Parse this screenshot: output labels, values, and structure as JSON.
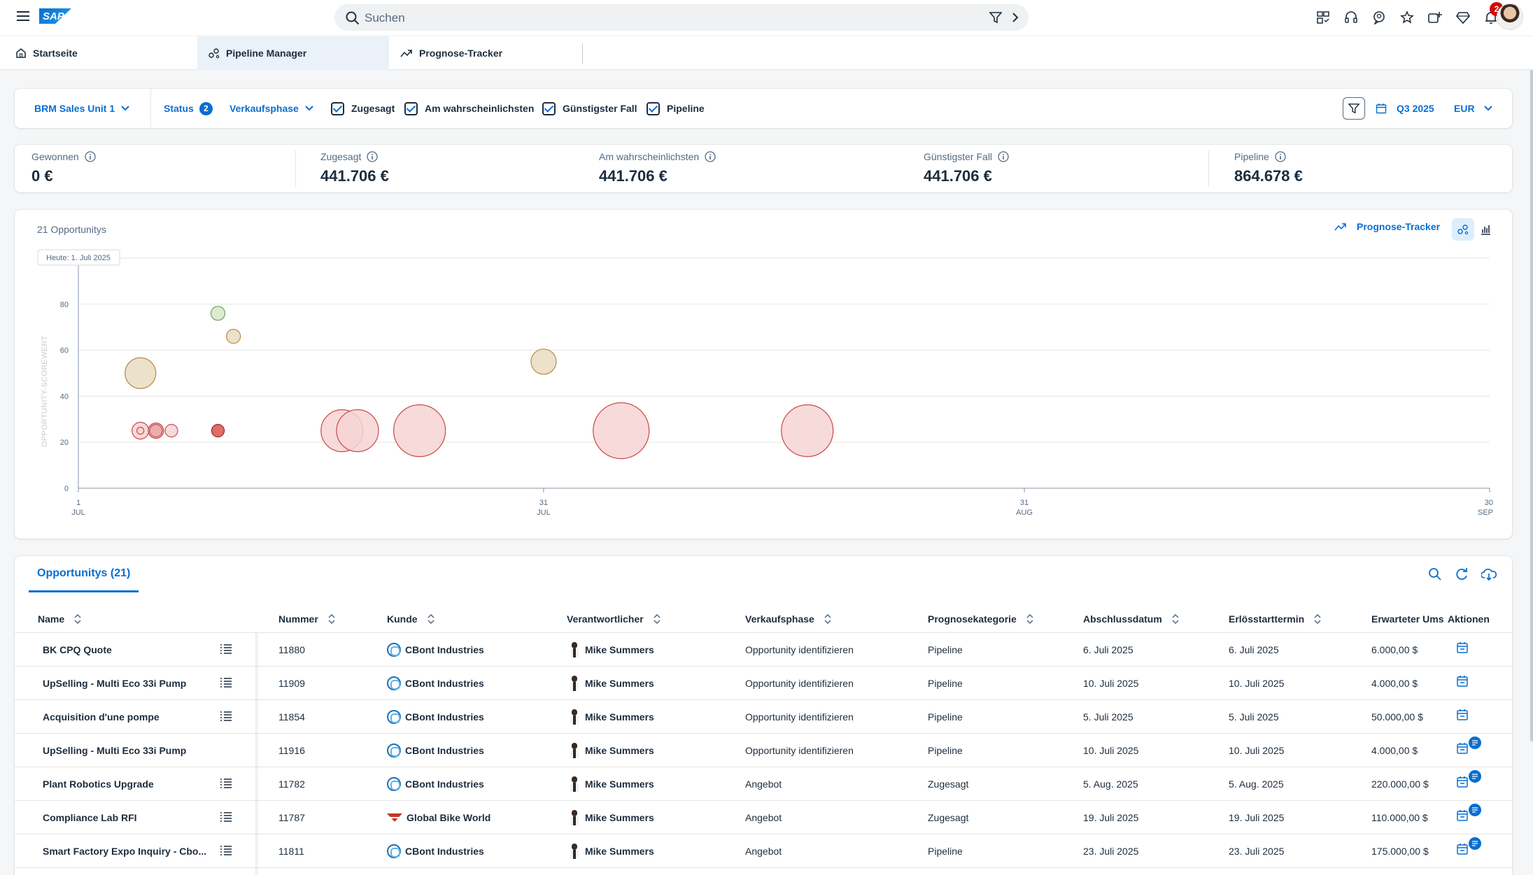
{
  "shell": {
    "logo": "SAP",
    "search_placeholder": "Suchen",
    "notification_count": "2",
    "icons": [
      "app-switcher-icon",
      "headset-icon",
      "chat-icon",
      "star-icon",
      "add-favorite-icon",
      "diamond-icon",
      "bell-icon"
    ]
  },
  "tabs": [
    {
      "label": "Startseite",
      "icon": "home-icon"
    },
    {
      "label": "Pipeline Manager",
      "icon": "pipeline-icon"
    },
    {
      "label": "Prognose-Tracker",
      "icon": "trend-icon"
    }
  ],
  "filterbar": {
    "unit": "BRM Sales Unit 1",
    "status_label": "Status",
    "status_count": "2",
    "phase": "Verkaufsphase",
    "checks": [
      "Zugesagt",
      "Am wahrscheinlichsten",
      "Günstigster Fall",
      "Pipeline"
    ],
    "period": "Q3 2025",
    "currency": "EUR"
  },
  "kpis": [
    {
      "label": "Gewonnen",
      "value": "0 €"
    },
    {
      "label": "Zugesagt",
      "value": "441.706 €"
    },
    {
      "label": "Am wahrscheinlichsten",
      "value": "441.706 €"
    },
    {
      "label": "Günstigster Fall",
      "value": "441.706 €"
    },
    {
      "label": "Pipeline",
      "value": "864.678 €"
    }
  ],
  "chart_header": {
    "count": "21 Opportunitys",
    "link": "Prognose-Tracker"
  },
  "chart_data": {
    "type": "scatter",
    "today_label": "Heute: 1. Juli 2025",
    "ylabel": "OPPORTUNITY-SCOREWERT",
    "xlabel": "",
    "ylim": [
      0,
      100
    ],
    "yticks": [
      0,
      20,
      40,
      60,
      80
    ],
    "xlim_days": [
      0,
      91
    ],
    "xticks": [
      {
        "day": 0,
        "d": "1",
        "m": "JUL"
      },
      {
        "day": 30,
        "d": "31",
        "m": "JUL"
      },
      {
        "day": 61,
        "d": "31",
        "m": "AUG"
      },
      {
        "day": 91,
        "d": "30",
        "m": "SEP"
      }
    ],
    "points": [
      {
        "day": 4,
        "y": 50,
        "r": 22,
        "c": "#e9dcc2",
        "s": "#b98a45"
      },
      {
        "day": 9,
        "y": 76,
        "r": 10,
        "c": "#d7e8c9",
        "s": "#6fa05a"
      },
      {
        "day": 10,
        "y": 66,
        "r": 10,
        "c": "#e9dcc2",
        "s": "#b98a45"
      },
      {
        "day": 30,
        "y": 55,
        "r": 18,
        "c": "#e9dcc2",
        "s": "#b98a45"
      },
      {
        "day": 4,
        "y": 25,
        "r": 12,
        "c": "#f6d3d3",
        "s": "#c94a4a"
      },
      {
        "day": 4,
        "y": 25,
        "r": 5,
        "c": "#f6d3d3",
        "s": "#c94a4a"
      },
      {
        "day": 5,
        "y": 25,
        "r": 11,
        "c": "#eebcbc",
        "s": "#c94a4a"
      },
      {
        "day": 5,
        "y": 25,
        "r": 9,
        "c": "#e9a9a9",
        "s": "#c94a4a"
      },
      {
        "day": 6,
        "y": 25,
        "r": 9,
        "c": "#f6d3d3",
        "s": "#c94a4a"
      },
      {
        "day": 9,
        "y": 25,
        "r": 9,
        "c": "#d9534f",
        "s": "#9b2222"
      },
      {
        "day": 17,
        "y": 25,
        "r": 30,
        "c": "#f6d3d3",
        "s": "#c94a4a"
      },
      {
        "day": 18,
        "y": 25,
        "r": 30,
        "c": "#f6d3d3",
        "s": "#c94a4a"
      },
      {
        "day": 22,
        "y": 25,
        "r": 37,
        "c": "#f6d3d3",
        "s": "#c94a4a"
      },
      {
        "day": 35,
        "y": 25,
        "r": 40,
        "c": "#f6d3d3",
        "s": "#c94a4a"
      },
      {
        "day": 47,
        "y": 25,
        "r": 37,
        "c": "#f6d3d3",
        "s": "#c94a4a"
      }
    ]
  },
  "table": {
    "tab_label": "Opportunitys (21)",
    "columns": [
      "Name",
      "Nummer",
      "Kunde",
      "Verantwortlicher",
      "Verkaufsphase",
      "Prognosekategorie",
      "Abschlussdatum",
      "Erlösstarttermin",
      "Erwarteter Umsatz",
      "Aktionen"
    ],
    "rows": [
      {
        "name": "BK CPQ Quote",
        "num": "11880",
        "cust": "CBont Industries",
        "cust_type": "cbont",
        "owner": "Mike Summers",
        "phase": "Opportunity identifizieren",
        "cat": "Pipeline",
        "close": "6. Juli 2025",
        "rev": "6. Juli 2025",
        "amt": "6.000,00 $",
        "list": true,
        "note": false
      },
      {
        "name": "UpSelling - Multi Eco 33i Pump",
        "num": "11909",
        "cust": "CBont Industries",
        "cust_type": "cbont",
        "owner": "Mike Summers",
        "phase": "Opportunity identifizieren",
        "cat": "Pipeline",
        "close": "10. Juli 2025",
        "rev": "10. Juli 2025",
        "amt": "4.000,00 $",
        "list": true,
        "note": false
      },
      {
        "name": "Acquisition d'une pompe",
        "num": "11854",
        "cust": "CBont Industries",
        "cust_type": "cbont",
        "owner": "Mike Summers",
        "phase": "Opportunity identifizieren",
        "cat": "Pipeline",
        "close": "5. Juli 2025",
        "rev": "5. Juli 2025",
        "amt": "50.000,00 $",
        "list": true,
        "note": false
      },
      {
        "name": "UpSelling - Multi Eco 33i Pump",
        "num": "11916",
        "cust": "CBont Industries",
        "cust_type": "cbont",
        "owner": "Mike Summers",
        "phase": "Opportunity identifizieren",
        "cat": "Pipeline",
        "close": "10. Juli 2025",
        "rev": "10. Juli 2025",
        "amt": "4.000,00 $",
        "list": false,
        "note": true
      },
      {
        "name": "Plant Robotics Upgrade",
        "num": "11782",
        "cust": "CBont Industries",
        "cust_type": "cbont",
        "owner": "Mike Summers",
        "phase": "Angebot",
        "cat": "Zugesagt",
        "close": "5. Aug. 2025",
        "rev": "5. Aug. 2025",
        "amt": "220.000,00 $",
        "list": true,
        "note": true
      },
      {
        "name": "Compliance Lab RFI",
        "num": "11787",
        "cust": "Global Bike World",
        "cust_type": "gbw",
        "owner": "Mike Summers",
        "phase": "Angebot",
        "cat": "Zugesagt",
        "close": "19. Juli 2025",
        "rev": "19. Juli 2025",
        "amt": "110.000,00 $",
        "list": true,
        "note": true
      },
      {
        "name": "Smart Factory Expo Inquiry - Cbo...",
        "num": "11811",
        "cust": "CBont Industries",
        "cust_type": "cbont",
        "owner": "Mike Summers",
        "phase": "Angebot",
        "cat": "Pipeline",
        "close": "23. Juli 2025",
        "rev": "23. Juli 2025",
        "amt": "175.000,00 $",
        "list": true,
        "note": true
      }
    ]
  }
}
